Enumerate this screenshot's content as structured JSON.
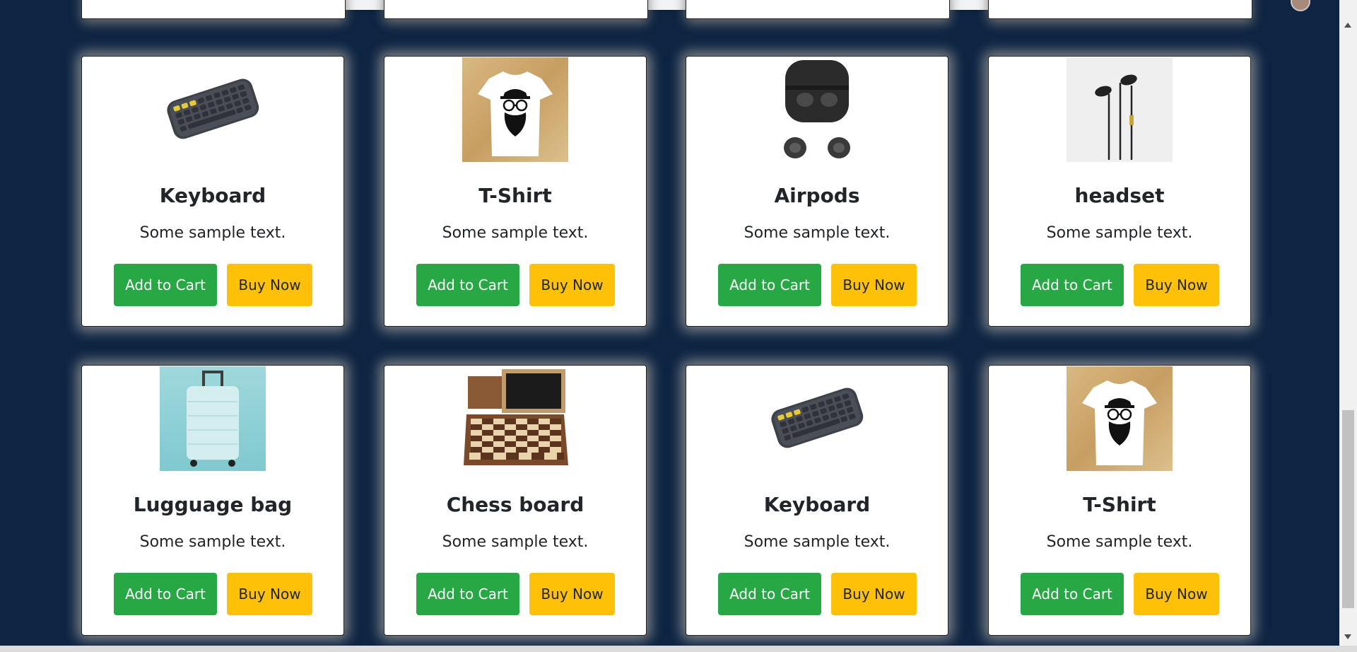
{
  "products": [
    {
      "name": "Keyboard",
      "text": "Some sample text.",
      "image": "keyboard-image"
    },
    {
      "name": "T-Shirt",
      "text": "Some sample text.",
      "image": "tshirt-image"
    },
    {
      "name": "Airpods",
      "text": "Some sample text.",
      "image": "airpods-image"
    },
    {
      "name": "headset",
      "text": "Some sample text.",
      "image": "headset-image"
    },
    {
      "name": "Lugguage bag",
      "text": "Some sample text.",
      "image": "luggage-image"
    },
    {
      "name": "Chess board",
      "text": "Some sample text.",
      "image": "chess-board-image"
    },
    {
      "name": "Keyboard",
      "text": "Some sample text.",
      "image": "keyboard-image"
    },
    {
      "name": "T-Shirt",
      "text": "Some sample text.",
      "image": "tshirt-image"
    }
  ],
  "buttons": {
    "add_to_cart": "Add to Cart",
    "buy_now": "Buy Now"
  },
  "colors": {
    "page_background": "#0d2442",
    "card_background": "#ffffff",
    "add_to_cart": "#28a745",
    "buy_now": "#ffc107"
  }
}
